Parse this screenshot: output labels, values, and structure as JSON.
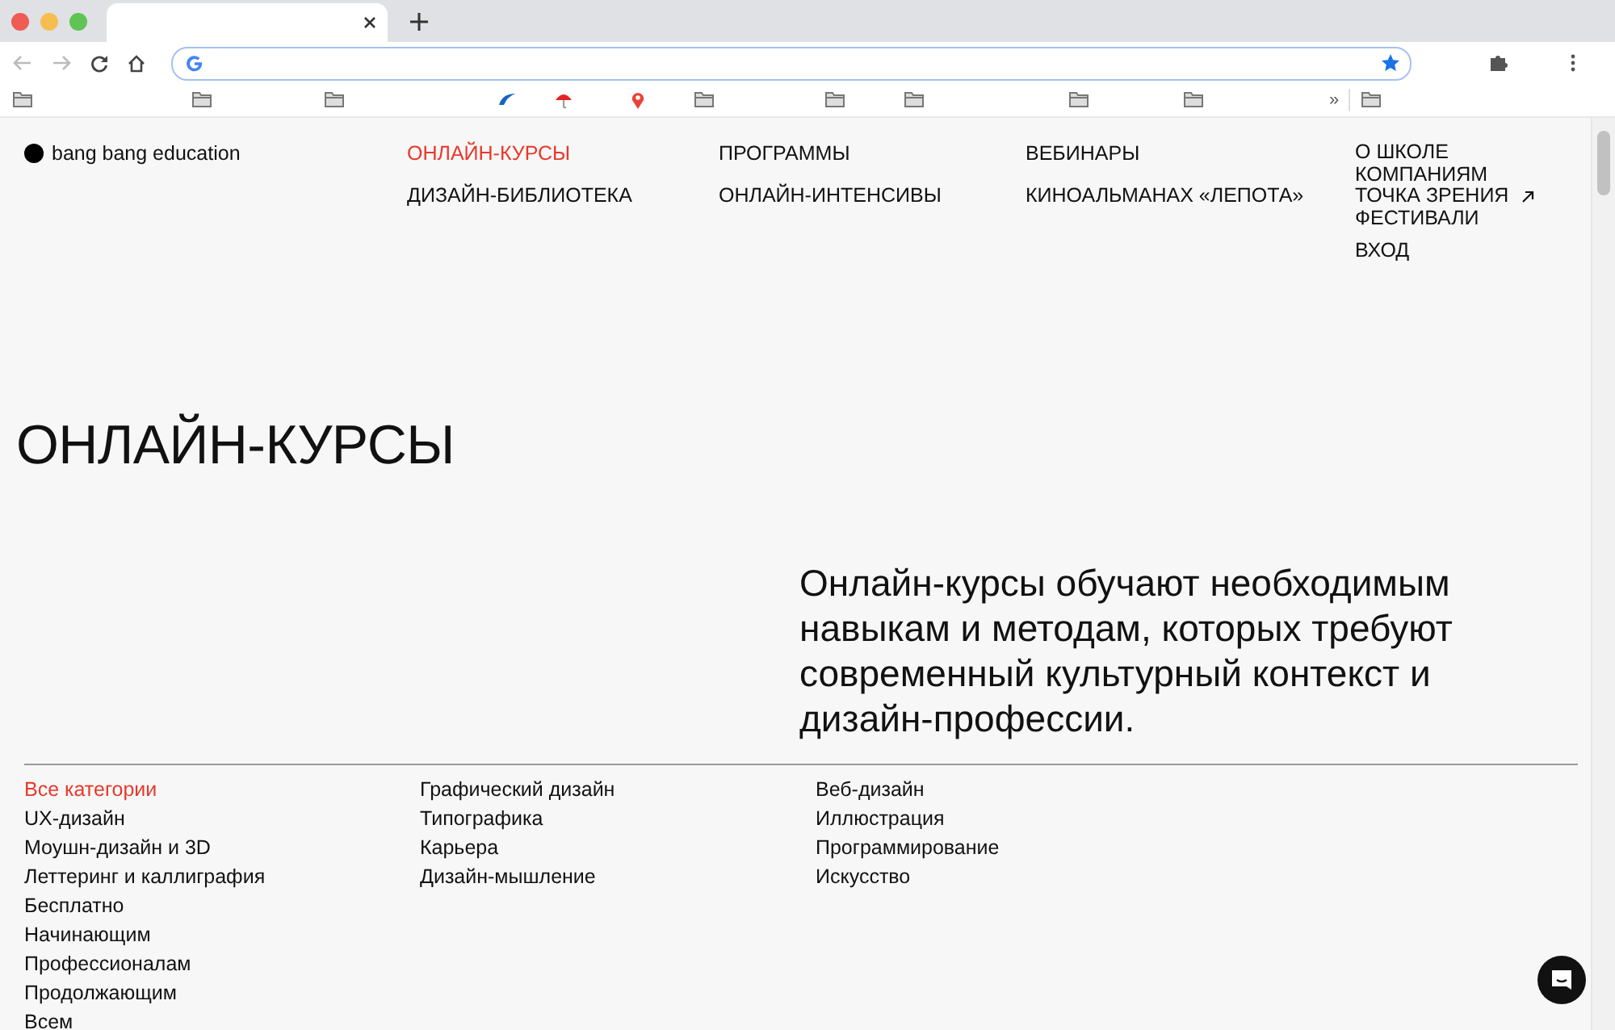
{
  "browser": {
    "bookmarks": [
      {
        "kind": "folder"
      },
      {
        "kind": "folder"
      },
      {
        "kind": "folder"
      },
      {
        "kind": "wave"
      },
      {
        "kind": "umbrella"
      },
      {
        "kind": "pin"
      },
      {
        "kind": "folder"
      },
      {
        "kind": "folder"
      },
      {
        "kind": "folder"
      },
      {
        "kind": "folder"
      },
      {
        "kind": "folder"
      }
    ],
    "overflow": "»",
    "other_bookmarks": {
      "kind": "folder"
    }
  },
  "site": {
    "logo": "bang bang education",
    "nav_columns": [
      [
        {
          "label": "ОНЛАЙН-КУРСЫ",
          "selected": true
        },
        {
          "label": "ДИЗАЙН-БИБЛИОТЕКА",
          "selected": false
        }
      ],
      [
        {
          "label": "ПРОГРАММЫ",
          "selected": false
        },
        {
          "label": "ОНЛАЙН-ИНТЕНСИВЫ",
          "selected": false
        }
      ],
      [
        {
          "label": "ВЕБИНАРЫ",
          "selected": false
        },
        {
          "label": "КИНОАЛЬМАНАХ «ЛЕПОТА»",
          "selected": false
        }
      ]
    ],
    "about_links": [
      {
        "label": "О ШКОЛЕ",
        "external": false
      },
      {
        "label": "КОМПАНИЯМ",
        "external": false
      },
      {
        "label": "ТОЧКА ЗРЕНИЯ",
        "external": true
      },
      {
        "label": "ФЕСТИВАЛИ",
        "external": false
      }
    ],
    "login": "ВХОД",
    "heading": "ОНЛАЙН-КУРСЫ",
    "intro": "Онлайн-курсы обучают необходимым навыкам и методам, которых требуют современный культурный контекст и дизайн-профессии.",
    "category_columns": [
      [
        {
          "label": "Все категории",
          "selected": true
        },
        {
          "label": "UX-дизайн",
          "selected": false
        },
        {
          "label": "Моушн-дизайн и 3D",
          "selected": false
        },
        {
          "label": "Леттеринг и каллиграфия",
          "selected": false
        },
        {
          "label": "Бесплатно",
          "selected": false
        },
        {
          "label": "Начинающим",
          "selected": false
        },
        {
          "label": "Профессионалам",
          "selected": false
        },
        {
          "label": "Продолжающим",
          "selected": false
        },
        {
          "label": "Всем",
          "selected": false
        }
      ],
      [
        {
          "label": "Графический дизайн",
          "selected": false
        },
        {
          "label": "Типографика",
          "selected": false
        },
        {
          "label": "Карьера",
          "selected": false
        },
        {
          "label": "Дизайн-мышление",
          "selected": false
        }
      ],
      [
        {
          "label": "Веб-дизайн",
          "selected": false
        },
        {
          "label": "Иллюстрация",
          "selected": false
        },
        {
          "label": "Программирование",
          "selected": false
        },
        {
          "label": "Искусство",
          "selected": false
        }
      ]
    ]
  }
}
